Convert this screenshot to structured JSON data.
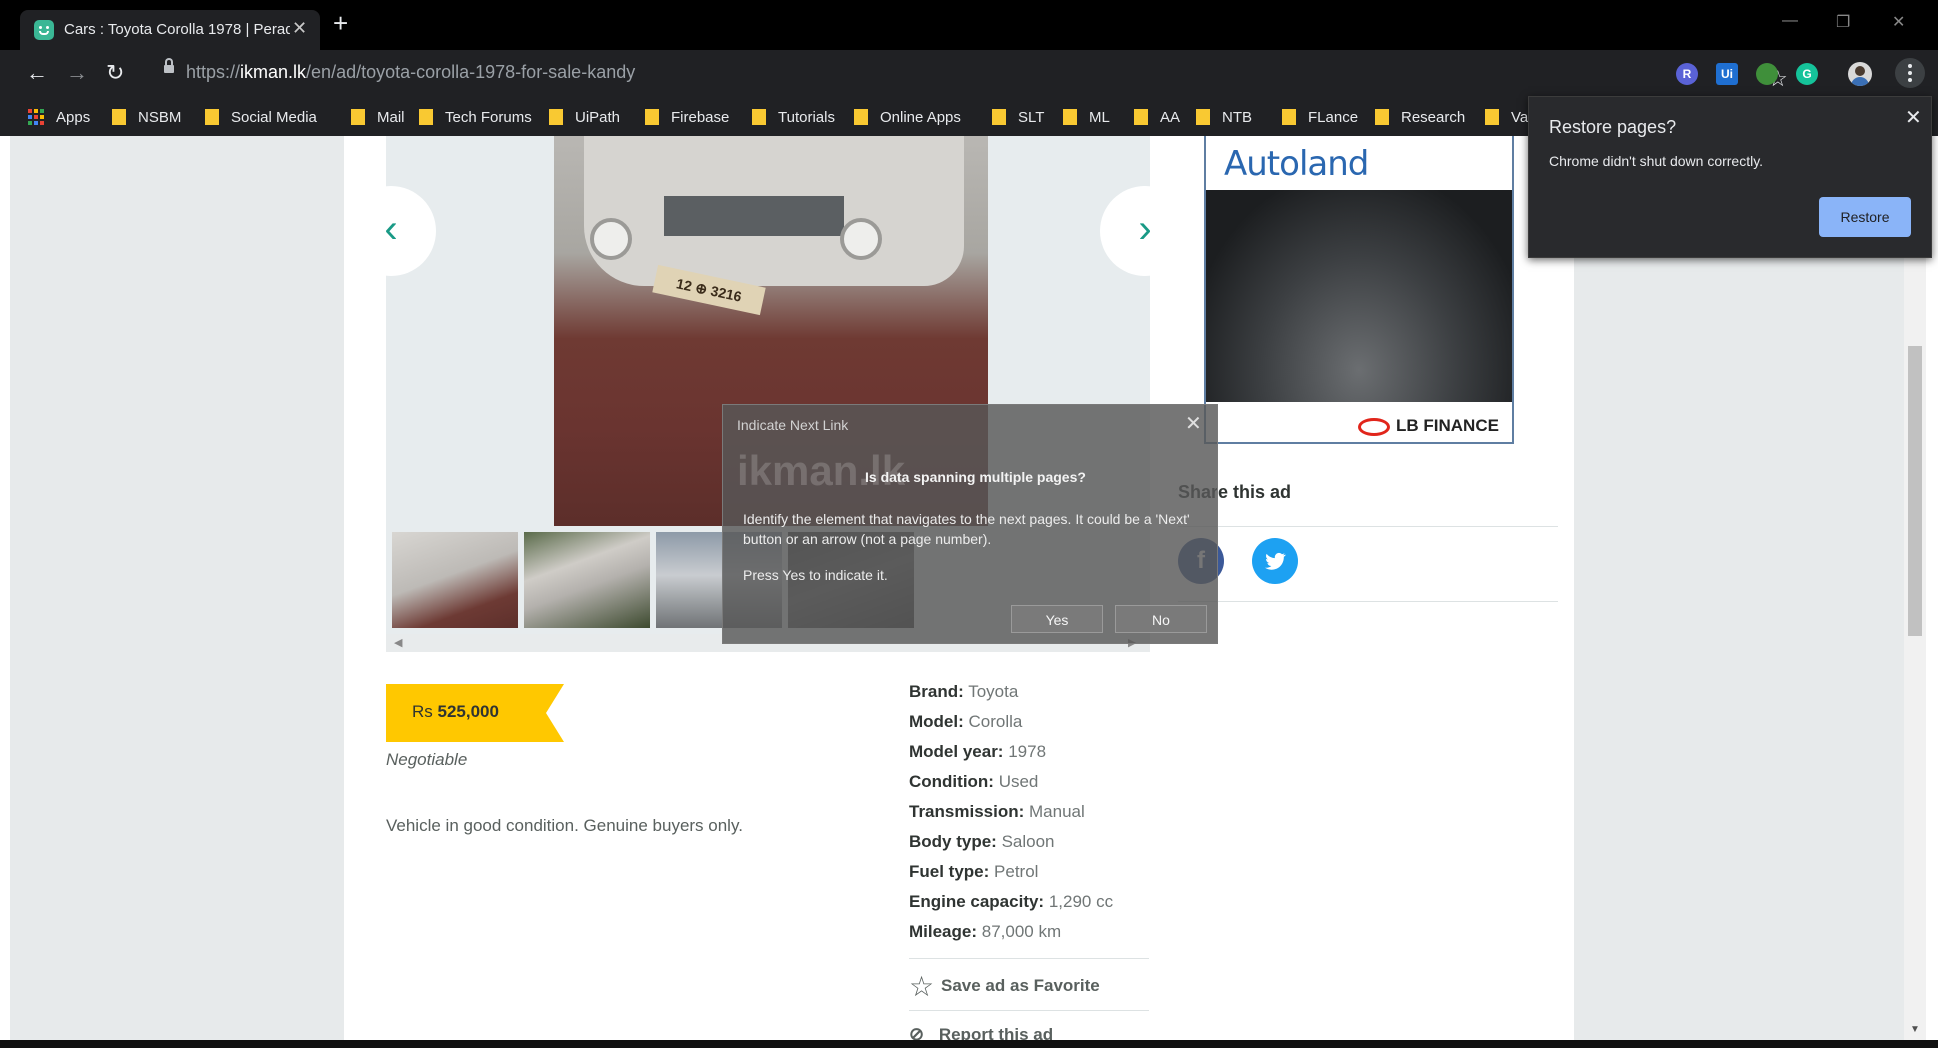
{
  "browser": {
    "tab_title": "Cars : Toyota Corolla 1978 | Perad",
    "url_scheme": "https://",
    "url_host": "ikman.lk",
    "url_path": "/en/ad/toyota-corolla-1978-for-sale-kandy",
    "new_tab": "+",
    "close_tab": "✕",
    "window_minimize": "—",
    "window_restore": "❐",
    "window_close": "✕",
    "back": "←",
    "forward": "→",
    "reload": "↻",
    "star": "☆",
    "extensions": [
      {
        "name": "extension-r-icon",
        "label": "R",
        "color": "#5a62d6"
      },
      {
        "name": "uipath-extension-icon",
        "label": "Ui",
        "color": "#1f6fd1"
      },
      {
        "name": "extension-leaf-icon",
        "label": "",
        "color": "#3f8f3a"
      },
      {
        "name": "grammarly-icon",
        "label": "G",
        "color": "#15c39a"
      }
    ]
  },
  "bookmarks": [
    "Apps",
    "NSBM",
    "Social Media",
    "Mail",
    "Tech Forums",
    "UiPath",
    "Firebase",
    "Tutorials",
    "Online Apps",
    "SLT",
    "ML",
    "AA",
    "NTB",
    "FLance",
    "Research",
    "Va"
  ],
  "gallery": {
    "prev": "‹",
    "next": "›",
    "plate": "12 ⊕ 3216"
  },
  "ad": {
    "title": "Autoland",
    "brand": "LB FINANCE"
  },
  "share": {
    "title": "Share this ad",
    "facebook": "f",
    "twitter": "t"
  },
  "listing": {
    "currency": "Rs",
    "price": "525,000",
    "negotiable": "Negotiable",
    "description": "Vehicle in good condition. Genuine buyers only.",
    "properties": [
      {
        "label": "Brand:",
        "value": "Toyota"
      },
      {
        "label": "Model:",
        "value": "Corolla"
      },
      {
        "label": "Model year:",
        "value": "1978"
      },
      {
        "label": "Condition:",
        "value": "Used"
      },
      {
        "label": "Transmission:",
        "value": "Manual"
      },
      {
        "label": "Body type:",
        "value": "Saloon"
      },
      {
        "label": "Fuel type:",
        "value": "Petrol"
      },
      {
        "label": "Engine capacity:",
        "value": "1,290 cc"
      },
      {
        "label": "Mileage:",
        "value": "87,000 km"
      }
    ],
    "favorite": "Save ad as Favorite",
    "report": "Report this ad"
  },
  "dialog": {
    "title": "Indicate Next Link",
    "close": "✕",
    "watermark": "ikman.lk",
    "heading": "Is data spanning multiple pages?",
    "body": "Identify the element that navigates to the next pages. It could be a 'Next' button or an arrow (not a page number).",
    "instruction": "Press Yes to indicate it.",
    "yes": "Yes",
    "no": "No"
  },
  "restore": {
    "title": "Restore pages?",
    "message": "Chrome didn't shut down correctly.",
    "button": "Restore",
    "close": "✕"
  }
}
